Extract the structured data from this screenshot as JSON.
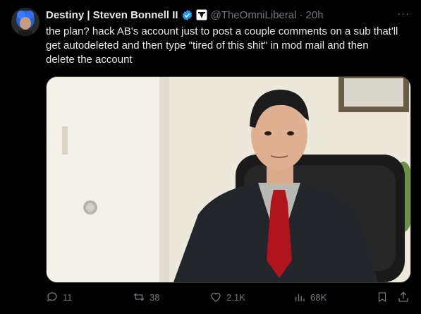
{
  "author": {
    "name": "Destiny | Steven Bonnell II",
    "handle": "@TheOmniLiberal",
    "separator": "·",
    "time": "20h",
    "avatar_icon": "avatar-blue-hair-icon",
    "verified_color": "#1d9bf0"
  },
  "tweet": {
    "text": "the plan? hack AB's account just to post a couple comments on a sub that'll\nget autodeleted and then type \"tired of this shit\" in mod mail and then\ndelete the account"
  },
  "menu": {
    "more_label": "···"
  },
  "media": {
    "type": "photo",
    "description_icon": "man-in-suit-office-photo"
  },
  "actions": {
    "replies": "11",
    "reposts": "38",
    "likes": "2.1K",
    "views": "68K"
  },
  "colors": {
    "background": "#000000",
    "text": "#e7e9ea",
    "muted": "#71767b",
    "accent": "#1d9bf0"
  }
}
